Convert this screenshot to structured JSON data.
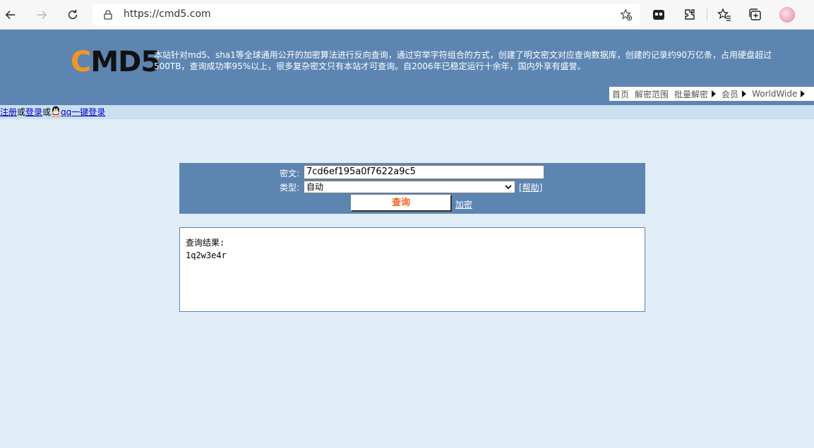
{
  "browser": {
    "url": "https://cmd5.com"
  },
  "header": {
    "logo_first": "C",
    "logo_rest": "MD5",
    "intro": "本站针对md5、sha1等全球通用公开的加密算法进行反向查询，通过穷举字符组合的方式，创建了明文密文对应查询数据库，创建的记录约90万亿条，占用硬盘超过500TB，查询成功率95%以上，很多复杂密文只有本站才可查询。自2006年已稳定运行十余年，国内外享有盛誉。",
    "menu": [
      "首页",
      "解密范围",
      "批量解密",
      "会员",
      "WorldWide"
    ]
  },
  "login": {
    "register": "注册",
    "or1": "或",
    "login": "登录",
    "or2": "或",
    "qq_login": "qq一键登录"
  },
  "query": {
    "cipher_label": "密文:",
    "cipher_value": "7cd6ef195a0f7622a9c5",
    "type_label": "类型:",
    "type_value": "自动",
    "help_open": "[",
    "help_text": "帮助",
    "help_close": "]",
    "submit_label": "查询",
    "encrypt_link": "加密"
  },
  "result": {
    "label": "查询结果:",
    "value": "1q2w3e4r"
  },
  "colors": {
    "header_bg": "#5c85b2",
    "logo_accent": "#f7941d",
    "page_bg": "#e1edf6",
    "submit_text": "#f26522"
  }
}
